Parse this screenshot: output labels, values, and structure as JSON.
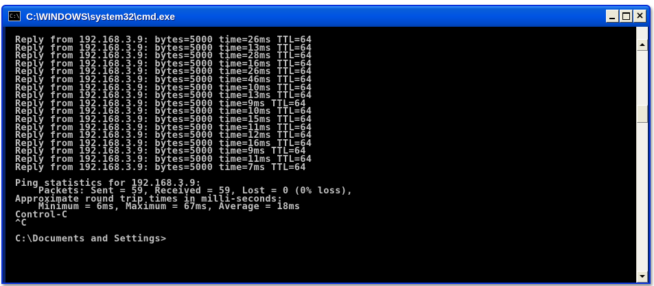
{
  "window": {
    "title": "C:\\WINDOWS\\system32\\cmd.exe",
    "icon_name": "cmd-console-icon",
    "icon_glyph": "C:\\",
    "buttons": {
      "minimize": "minimize-icon",
      "maximize": "maximize-icon",
      "close_glyph": "×"
    }
  },
  "console": {
    "background": "#000000",
    "foreground": "#c0c0c0",
    "lines": [
      "Reply from 192.168.3.9: bytes=5000 time=26ms TTL=64",
      "Reply from 192.168.3.9: bytes=5000 time=13ms TTL=64",
      "Reply from 192.168.3.9: bytes=5000 time=28ms TTL=64",
      "Reply from 192.168.3.9: bytes=5000 time=16ms TTL=64",
      "Reply from 192.168.3.9: bytes=5000 time=26ms TTL=64",
      "Reply from 192.168.3.9: bytes=5000 time=46ms TTL=64",
      "Reply from 192.168.3.9: bytes=5000 time=10ms TTL=64",
      "Reply from 192.168.3.9: bytes=5000 time=13ms TTL=64",
      "Reply from 192.168.3.9: bytes=5000 time=9ms TTL=64",
      "Reply from 192.168.3.9: bytes=5000 time=10ms TTL=64",
      "Reply from 192.168.3.9: bytes=5000 time=15ms TTL=64",
      "Reply from 192.168.3.9: bytes=5000 time=11ms TTL=64",
      "Reply from 192.168.3.9: bytes=5000 time=12ms TTL=64",
      "Reply from 192.168.3.9: bytes=5000 time=16ms TTL=64",
      "Reply from 192.168.3.9: bytes=5000 time=9ms TTL=64",
      "Reply from 192.168.3.9: bytes=5000 time=11ms TTL=64",
      "Reply from 192.168.3.9: bytes=5000 time=7ms TTL=64",
      "",
      "Ping statistics for 192.168.3.9:",
      "    Packets: Sent = 59, Received = 59, Lost = 0 (0% loss),",
      "Approximate round trip times in milli-seconds:",
      "    Minimum = 6ms, Maximum = 67ms, Average = 18ms",
      "Control-C",
      "^C",
      "",
      "C:\\Documents and Settings>"
    ]
  },
  "scrollbar": {
    "up_arrow": "scroll-up-arrow-icon",
    "down_arrow": "scroll-down-arrow-icon",
    "position": 0.3
  }
}
